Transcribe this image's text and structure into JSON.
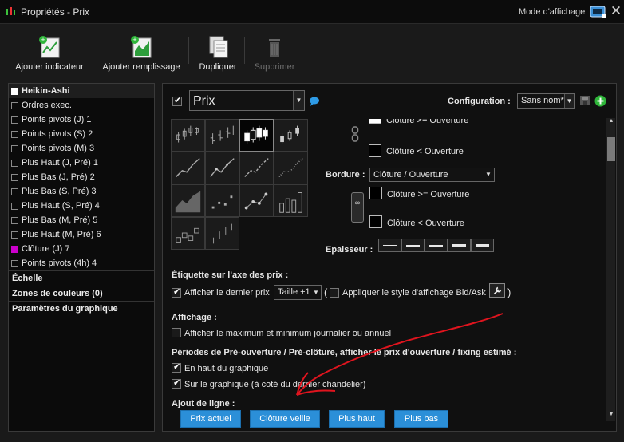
{
  "window": {
    "title": "Propriétés - Prix",
    "mode_label": "Mode d'affichage",
    "close_symbol": "✕"
  },
  "toolbar": {
    "add_indicator": "Ajouter indicateur",
    "add_fill": "Ajouter remplissage",
    "duplicate": "Dupliquer",
    "delete": "Supprimer"
  },
  "left": {
    "items": [
      {
        "label": "Heikin-Ashi",
        "box": "white",
        "selected": true
      },
      {
        "label": "Ordres exec.",
        "box": "empty"
      },
      {
        "label": "Points pivots (J) 1",
        "box": "empty"
      },
      {
        "label": "Points pivots (S) 2",
        "box": "empty"
      },
      {
        "label": "Points pivots (M) 3",
        "box": "empty"
      },
      {
        "label": "Plus Haut (J, Pré) 1",
        "box": "empty"
      },
      {
        "label": "Plus Bas (J, Pré) 2",
        "box": "empty"
      },
      {
        "label": "Plus Bas (S, Pré) 3",
        "box": "empty"
      },
      {
        "label": "Plus Haut (S, Pré) 4",
        "box": "empty"
      },
      {
        "label": "Plus Bas (M, Pré) 5",
        "box": "empty"
      },
      {
        "label": "Plus Haut (M, Pré) 6",
        "box": "empty"
      },
      {
        "label": "Clôture (J) 7",
        "box": "magenta"
      },
      {
        "label": "Points pivots (4h) 4",
        "box": "empty"
      }
    ],
    "sections": [
      "Échelle",
      "Zones de couleurs (0)",
      "Paramètres du graphique"
    ]
  },
  "right": {
    "series_value": "Prix",
    "config_label": "Configuration :",
    "config_value": "Sans nom*",
    "candle_up_top": "Clôture >= Ouverture",
    "candle_down_top": "Clôture < Ouverture",
    "border_label": "Bordure :",
    "border_value": "Clôture / Ouverture",
    "border_up": "Clôture >= Ouverture",
    "border_down": "Clôture < Ouverture",
    "thickness_label": "Epaisseur :",
    "axis_label_title": "Étiquette sur l'axe des prix :",
    "show_last_price": "Afficher le dernier prix",
    "size_value": "Taille +1",
    "apply_bidask": "Appliquer le style d'affichage Bid/Ask",
    "display_title": "Affichage :",
    "show_minmax": "Afficher le maximum et minimum journalier ou annuel",
    "preopen_title": "Périodes de Pré-ouverture / Pré-clôture, afficher le prix d'ouverture / fixing estimé :",
    "top_of_chart": "En haut du graphique",
    "on_chart": "Sur le graphique (à coté du dernier chandelier)",
    "add_line_title": "Ajout de ligne :",
    "btn_current_price": "Prix actuel",
    "btn_prev_close": "Clôture veille",
    "btn_high": "Plus haut",
    "btn_low": "Plus bas"
  },
  "colors": {
    "accent_blue": "#2b8fd8",
    "magenta": "#cc00cc",
    "annotation_red": "#e0141e",
    "add_green": "#2fb63a"
  }
}
